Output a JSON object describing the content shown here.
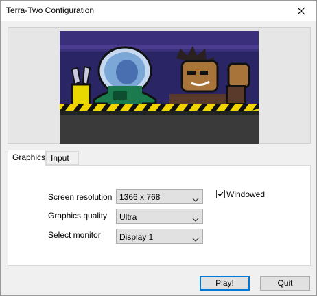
{
  "window": {
    "title": "Terra-Two Configuration"
  },
  "tabs": [
    {
      "label": "Graphics",
      "active": true
    },
    {
      "label": "Input",
      "active": false
    }
  ],
  "settings": {
    "resolution_label": "Screen resolution",
    "resolution_value": "1366 x 768",
    "quality_label": "Graphics quality",
    "quality_value": "Ultra",
    "monitor_label": "Select monitor",
    "monitor_value": "Display 1",
    "windowed_label": "Windowed",
    "windowed_checked": true
  },
  "buttons": {
    "play": "Play!",
    "quit": "Quit"
  },
  "colors": {
    "accent": "#0078d7",
    "banner_bg": "#2a2666",
    "hazard_yellow": "#f2d400"
  },
  "icons": {
    "close": "close-icon",
    "chevron": "chevron-down-icon",
    "check": "checkmark-icon"
  }
}
